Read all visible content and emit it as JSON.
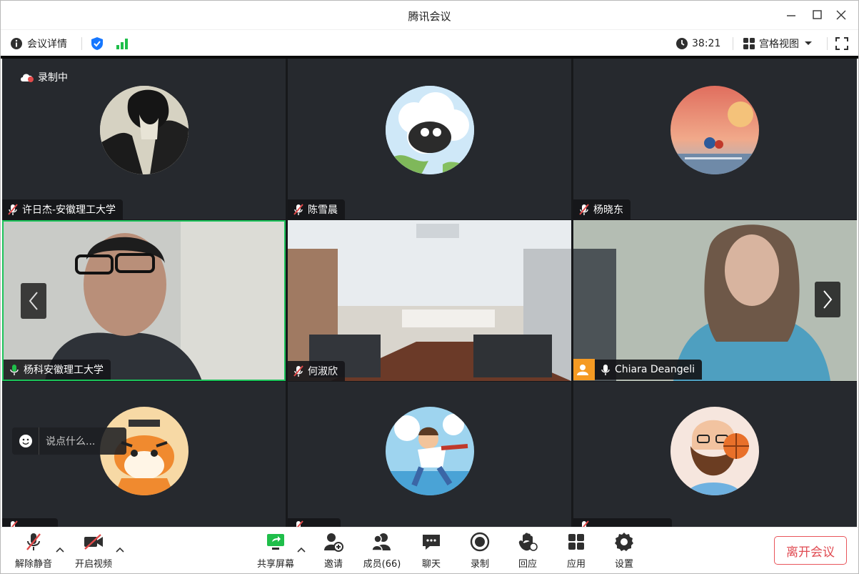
{
  "window": {
    "title": "腾讯会议"
  },
  "infobar": {
    "meeting_details": "会议详情",
    "timer": "38:21",
    "view_mode": "宫格视图"
  },
  "recording": {
    "label": "录制中"
  },
  "participants": [
    {
      "name": "许日杰-安徽理工大学",
      "muted": true,
      "type": "avatar"
    },
    {
      "name": "陈雪晨",
      "muted": true,
      "type": "avatar"
    },
    {
      "name": "杨晓东",
      "muted": true,
      "type": "avatar"
    },
    {
      "name": "杨科安徽理工大学",
      "muted": false,
      "type": "video",
      "active_speaker": true
    },
    {
      "name": "何淑欣",
      "muted": true,
      "type": "video"
    },
    {
      "name": "Chiara Deangeli",
      "muted": false,
      "type": "video"
    },
    {
      "name": "",
      "muted": true,
      "type": "avatar"
    },
    {
      "name": "",
      "muted": true,
      "type": "avatar"
    },
    {
      "name": "",
      "muted": true,
      "type": "avatar"
    }
  ],
  "chat": {
    "placeholder": "说点什么..."
  },
  "toolbar": {
    "unmute": "解除静音",
    "start_video": "开启视频",
    "share_screen": "共享屏幕",
    "invite": "邀请",
    "members": "成员(66)",
    "chat": "聊天",
    "record": "录制",
    "reactions": "回应",
    "apps": "应用",
    "settings": "设置",
    "leave": "离开会议"
  },
  "colors": {
    "brand_blue": "#1677ff",
    "signal_green": "#1fbe4a",
    "active_border": "#1cc35a",
    "mute_red": "#e24a4a",
    "leave_red": "#e04a51",
    "tile_bg": "#26292e"
  }
}
